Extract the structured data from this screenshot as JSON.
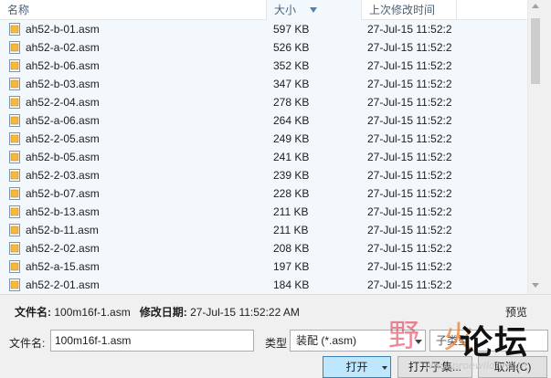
{
  "columns": {
    "name": "名称",
    "size": "大小",
    "date": "上次修改时间"
  },
  "files": [
    {
      "name": "ah52-b-01.asm",
      "size": "597 KB",
      "date": "27-Jul-15 11:52:2"
    },
    {
      "name": "ah52-a-02.asm",
      "size": "526 KB",
      "date": "27-Jul-15 11:52:2"
    },
    {
      "name": "ah52-b-06.asm",
      "size": "352 KB",
      "date": "27-Jul-15 11:52:2"
    },
    {
      "name": "ah52-b-03.asm",
      "size": "347 KB",
      "date": "27-Jul-15 11:52:2"
    },
    {
      "name": "ah52-2-04.asm",
      "size": "278 KB",
      "date": "27-Jul-15 11:52:2"
    },
    {
      "name": "ah52-a-06.asm",
      "size": "264 KB",
      "date": "27-Jul-15 11:52:2"
    },
    {
      "name": "ah52-2-05.asm",
      "size": "249 KB",
      "date": "27-Jul-15 11:52:2"
    },
    {
      "name": "ah52-b-05.asm",
      "size": "241 KB",
      "date": "27-Jul-15 11:52:2"
    },
    {
      "name": "ah52-2-03.asm",
      "size": "239 KB",
      "date": "27-Jul-15 11:52:2"
    },
    {
      "name": "ah52-b-07.asm",
      "size": "228 KB",
      "date": "27-Jul-15 11:52:2"
    },
    {
      "name": "ah52-b-13.asm",
      "size": "211 KB",
      "date": "27-Jul-15 11:52:2"
    },
    {
      "name": "ah52-b-11.asm",
      "size": "211 KB",
      "date": "27-Jul-15 11:52:2"
    },
    {
      "name": "ah52-2-02.asm",
      "size": "208 KB",
      "date": "27-Jul-15 11:52:2"
    },
    {
      "name": "ah52-a-15.asm",
      "size": "197 KB",
      "date": "27-Jul-15 11:52:2"
    },
    {
      "name": "ah52-2-01.asm",
      "size": "184 KB",
      "date": "27-Jul-15 11:52:2"
    }
  ],
  "info": {
    "filename_label": "文件名:",
    "filename_value": "100m16f-1.asm",
    "modified_label": "修改日期:",
    "modified_value": "27-Jul-15 11:52:22 AM",
    "preview": "预览"
  },
  "form": {
    "filename_label": "文件名:",
    "filename_value": "100m16f-1.asm",
    "type_label": "类型",
    "type_value": "装配 (*.asm)",
    "subtype_value": "子类型"
  },
  "buttons": {
    "open": "打开",
    "open_subset": "打开子集...",
    "cancel": "取消(C)"
  },
  "watermark": {
    "ye": "野",
    "huo": "火",
    "luntan": "论坛",
    "url": "www.proewildfire.cn"
  },
  "colors": {
    "accent": "#bee6fd",
    "row_bg": "#f2f8fc",
    "icon_fill": "#f4b942"
  }
}
